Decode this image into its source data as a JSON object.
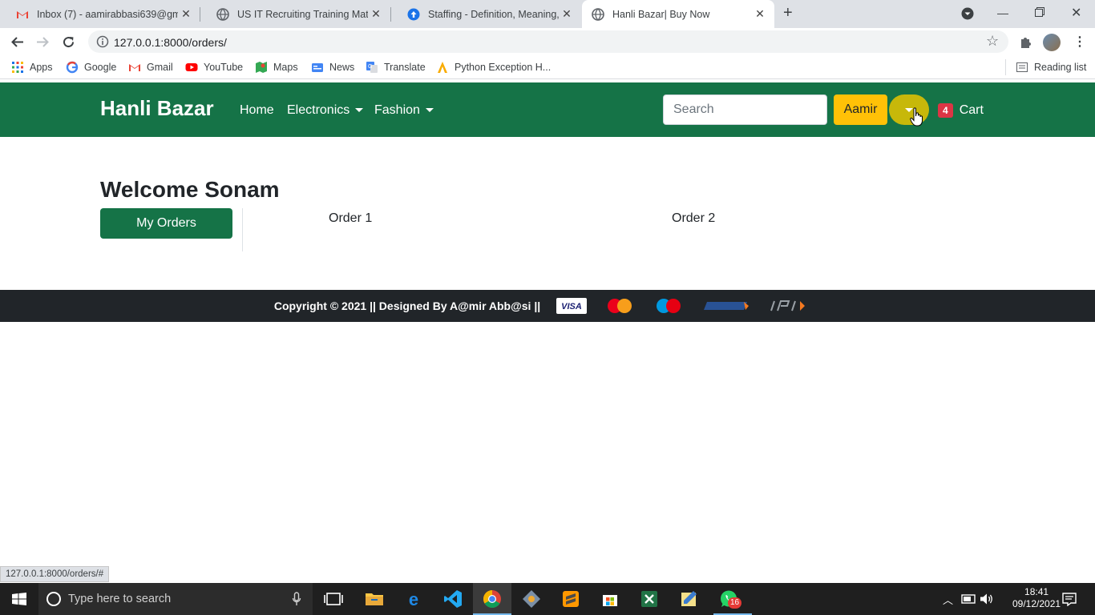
{
  "browser": {
    "tabs": [
      {
        "title": "Inbox (7) - aamirabbasi639@gm",
        "icon": "gmail-icon"
      },
      {
        "title": "US IT Recruiting Training Materia",
        "icon": "globe-icon"
      },
      {
        "title": "Staffing - Definition, Meaning, Fu",
        "icon": "upload-circle-icon"
      },
      {
        "title": "Hanli Bazar| Buy Now",
        "icon": "globe-icon",
        "active": true
      }
    ],
    "url": "127.0.0.1:8000/orders/",
    "bookmarks": [
      "Apps",
      "Google",
      "Gmail",
      "YouTube",
      "Maps",
      "News",
      "Translate",
      "Python Exception H..."
    ],
    "reading_list": "Reading list",
    "status_url": "127.0.0.1:8000/orders/#"
  },
  "site": {
    "brand": "Hanli Bazar",
    "nav": {
      "home": "Home",
      "electronics": "Electronics",
      "fashion": "Fashion"
    },
    "search_placeholder": "Search",
    "user_button": "Aamir",
    "cart_count": "4",
    "cart_label": "Cart",
    "colors": {
      "primary": "#157347",
      "warning": "#ffc107",
      "danger": "#dc3545",
      "footer": "#212529"
    }
  },
  "main": {
    "welcome": "Welcome Sonam",
    "my_orders": "My Orders",
    "orders": [
      "Order 1",
      "Order 2"
    ]
  },
  "footer": {
    "text": "Copyright © 2021 || Designed By A@mir Abb@si ||",
    "payment_icons": [
      "visa-icon",
      "mastercard-icon",
      "maestro-icon",
      "rupay-icon",
      "upi-icon"
    ]
  },
  "taskbar": {
    "search_placeholder": "Type here to search",
    "time": "18:41",
    "date": "09/12/2021",
    "whatsapp_badge": "16"
  }
}
